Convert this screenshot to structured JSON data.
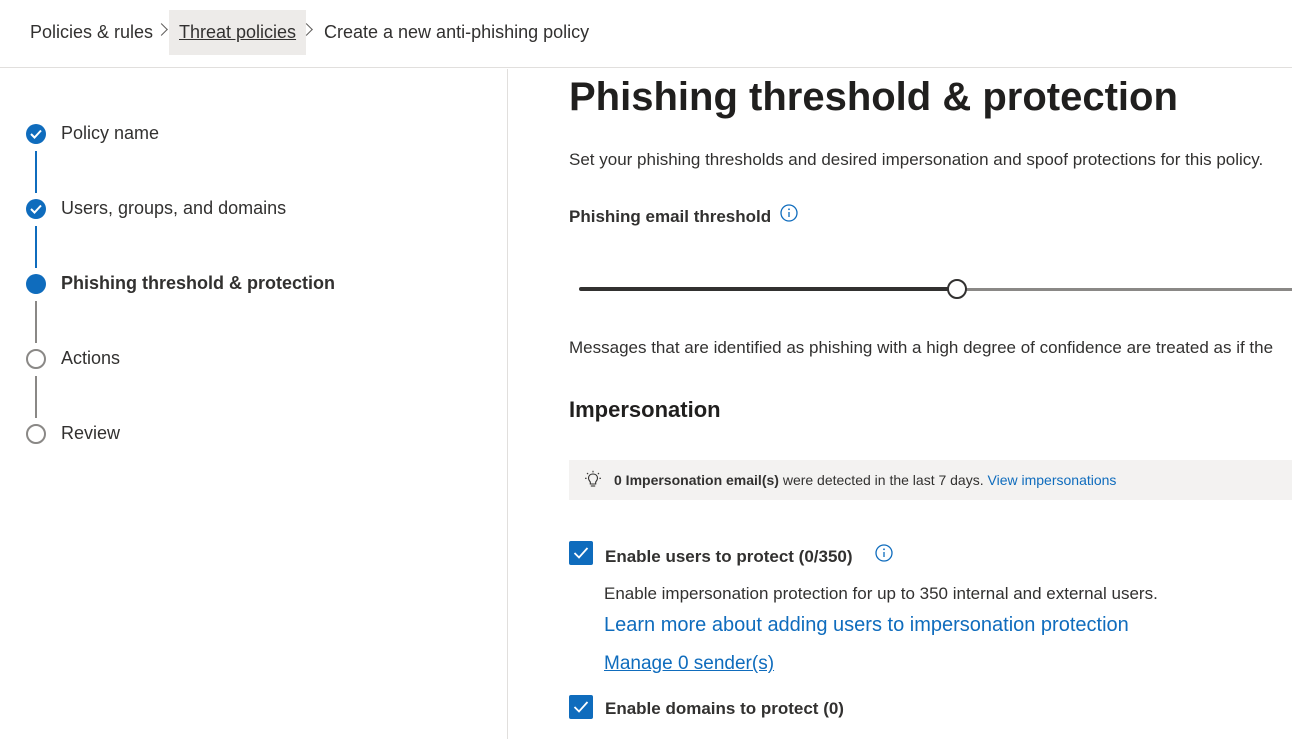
{
  "breadcrumb": {
    "items": [
      "Policies & rules",
      "Threat policies",
      "Create a new anti-phishing policy"
    ]
  },
  "wizard": {
    "steps": [
      {
        "label": "Policy name",
        "state": "completed"
      },
      {
        "label": "Users, groups, and domains",
        "state": "completed"
      },
      {
        "label": "Phishing threshold & protection",
        "state": "current"
      },
      {
        "label": "Actions",
        "state": "pending"
      },
      {
        "label": "Review",
        "state": "pending"
      }
    ]
  },
  "main": {
    "title": "Phishing threshold & protection",
    "description": "Set your phishing thresholds and desired impersonation and spoof protections for this policy.",
    "threshold": {
      "label": "Phishing email threshold",
      "slider_fraction": 0.53
    },
    "threshold_message": "Messages that are identified as phishing with a high degree of confidence are treated as if the",
    "impersonation": {
      "heading": "Impersonation",
      "banner": {
        "count_text": "0 Impersonation email(s)",
        "text": " were detected in the last 7 days. ",
        "link": "View impersonations"
      },
      "users": {
        "label": "Enable users to protect (0/350)",
        "checked": true,
        "description": "Enable impersonation protection for up to 350 internal and external users.",
        "learn_more": "Learn more about adding users to impersonation protection",
        "manage": "Manage 0 sender(s)"
      },
      "domains": {
        "label": "Enable domains to protect (0)",
        "checked": true
      }
    }
  },
  "colors": {
    "accent": "#0f6cbd",
    "text": "#323130",
    "banner_bg": "#f3f2f1"
  }
}
